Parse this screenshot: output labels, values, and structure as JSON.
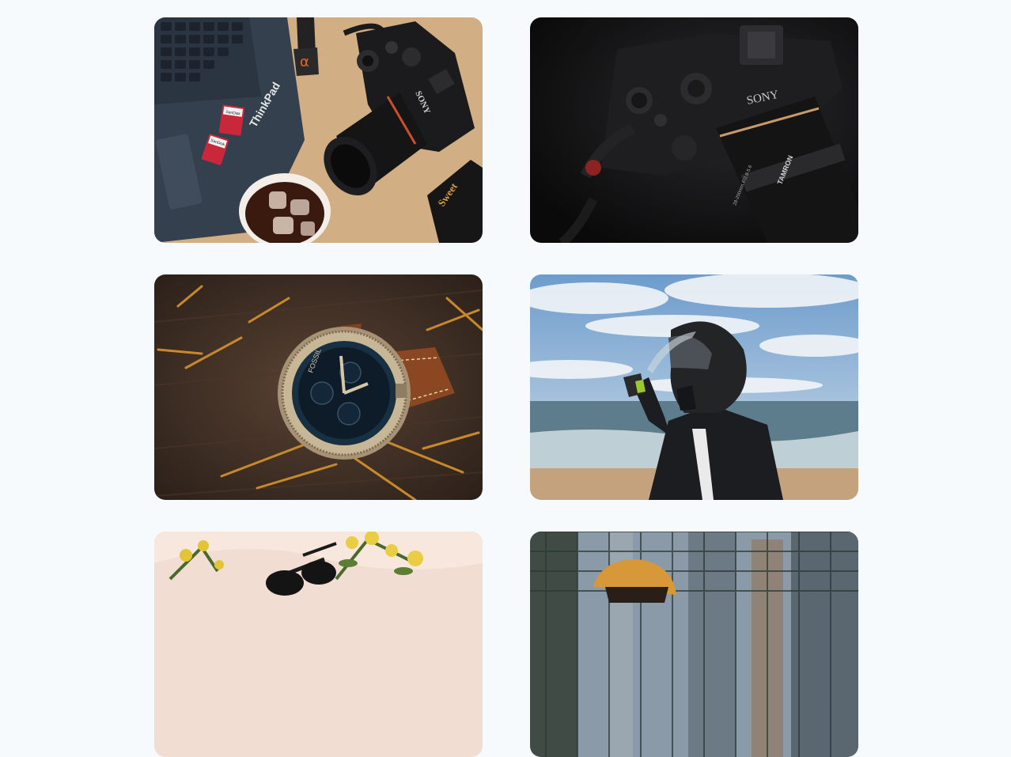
{
  "gallery": {
    "items": [
      {
        "id": "camera-desk",
        "labels": {
          "camera_brand": "SONY",
          "laptop_brand": "ThinkPad",
          "notebook_text": "Sweet",
          "strap_symbol": "α",
          "sd1": "SanDisk",
          "sd2": "SanDisk"
        }
      },
      {
        "id": "camera-dark",
        "labels": {
          "camera_brand": "SONY",
          "lens_brand": "TAMRON",
          "lens_spec": "28-200mm F/2.8-5.6"
        }
      },
      {
        "id": "watch",
        "labels": {
          "watch_brand": "FOSSIL"
        }
      },
      {
        "id": "helmet-beach",
        "labels": {}
      },
      {
        "id": "sunglasses-flowers",
        "labels": {}
      },
      {
        "id": "beanie-fence",
        "labels": {}
      }
    ]
  },
  "colors": {
    "page_bg": "#f6fafd",
    "wood": "#d7b48a",
    "laptop": "#34404e",
    "dark_bg": "#0c0c0d",
    "table_dark": "#3a2c22",
    "sky": "#6d9ccc",
    "sea": "#5d7d8c",
    "sand": "#c4a27e",
    "beanie": "#d69838"
  }
}
